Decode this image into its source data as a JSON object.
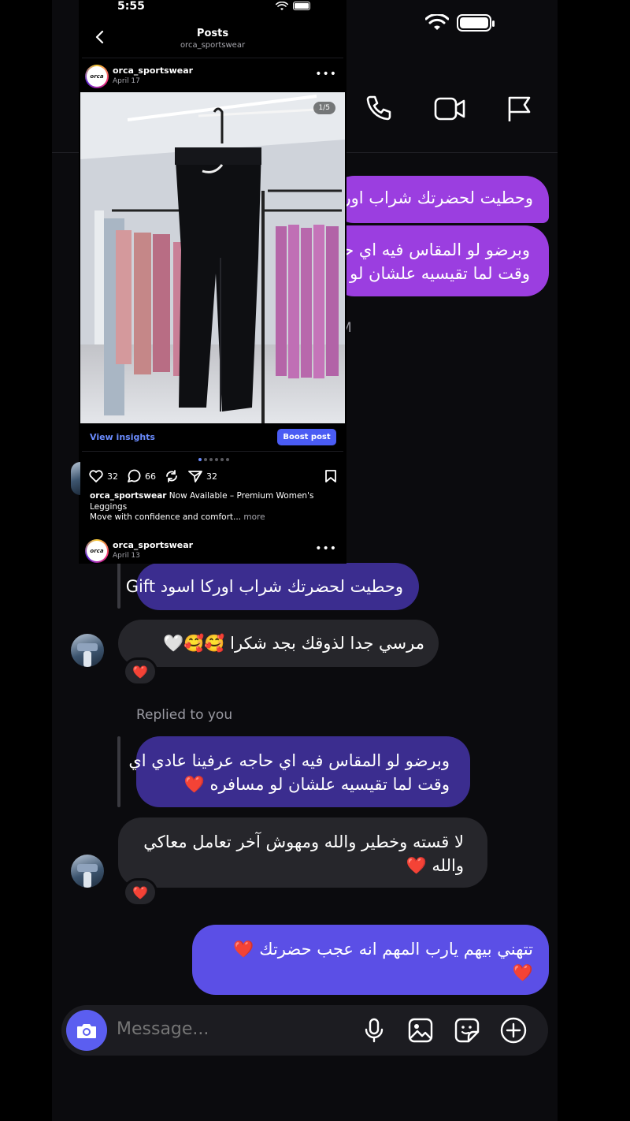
{
  "status_bar": {
    "time": "5:55"
  },
  "chat": {
    "messages": {
      "sent_top_1": "وحطيت لحضرتك شراب اوركا اسود Gift",
      "sent_top_2_line1": "وبرضو  لو المقاس فيه اي حاجه عرفينا عادي اي",
      "sent_top_2_line2": "وقت لما تقيسيه علشان لو مسافره",
      "time_fragment": "M",
      "quoted_gift": "وحطيت لحضرتك شراب اوركا اسود Gift",
      "received_1": "مرسي جدا لذوقك بجد  شكرا 🥰🥰🤍",
      "reaction_1": "❤️",
      "replied_label": "Replied to you",
      "quoted_reply_line1": "وبرضو  لو المقاس فيه اي حاجه عرفينا عادي اي",
      "quoted_reply_line2": "وقت لما تقيسيه علشان لو مسافره ❤️",
      "received_2_line1": "لا قسته وخطير والله ومهوش آخر تعامل معاكي",
      "received_2_line2": "والله ❤️",
      "reaction_2": "❤️",
      "sent_last_line1": "تتهني بيهم يارب المهم انه عجب حضرتك ❤️",
      "sent_last_line2": "❤️"
    },
    "composer": {
      "placeholder": "Message..."
    }
  },
  "post_view": {
    "title": "Posts",
    "subtitle": "orca_sportswear",
    "post1": {
      "logo_text": "orca",
      "username": "orca_sportswear",
      "date": "April 17",
      "more": "•••",
      "image_counter": "1/5",
      "view_insights": "View insights",
      "boost": "Boost post",
      "likes": "32",
      "comments": "66",
      "shares": "32",
      "caption_user": "orca_sportswear",
      "caption_text": " Now Available – Premium Women's Leggings",
      "caption_line2": "Move with confidence and comfort...",
      "caption_more": " more"
    },
    "post2": {
      "logo_text": "orca",
      "username": "orca_sportswear",
      "date": "April 13",
      "more": "•••"
    }
  },
  "colors": {
    "sent_bubble": "#9b3ee0",
    "reply_bubble": "#3b2d8f",
    "last_sent_bubble": "#5b4fe6",
    "received_bubble": "#26262b",
    "accent": "#5b5ef0"
  }
}
